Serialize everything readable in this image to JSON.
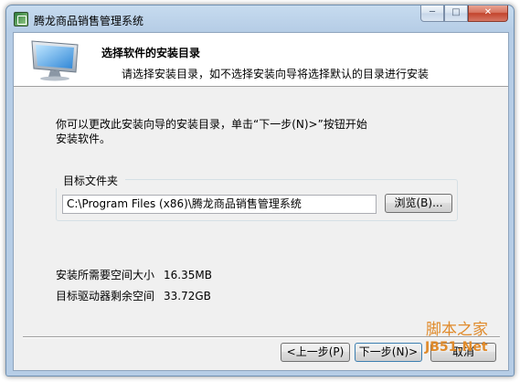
{
  "window": {
    "title": "腾龙商品销售管理系统",
    "caption_buttons": {
      "minimize": "─",
      "maximize": "□",
      "close": "✕"
    }
  },
  "header": {
    "title": "选择软件的安装目录",
    "subtitle": "请选择安装目录，如不选择安装向导将选择默认的目录进行安装",
    "graphic_icon": "computer-monitor-icon"
  },
  "intro_text": "你可以更改此安装向导的安装目录，单击“下一步(N)>”按钮开始安装软件。",
  "target_folder": {
    "group_label": "目标文件夹",
    "path_value": "C:\\Program Files (x86)\\腾龙商品销售管理系统",
    "browse_label": "浏览(B)..."
  },
  "space_info": {
    "required_label": "安装所需要空间大小",
    "required_value": "16.35MB",
    "remaining_label": "目标驱动器剩余空间",
    "remaining_value": "33.72GB"
  },
  "footer": {
    "back_label": "<上一步(P)",
    "next_label": "下一步(N)>",
    "cancel_label": "取消"
  },
  "watermark": {
    "line1": "脚本之家",
    "line2": "JB51.Net"
  }
}
